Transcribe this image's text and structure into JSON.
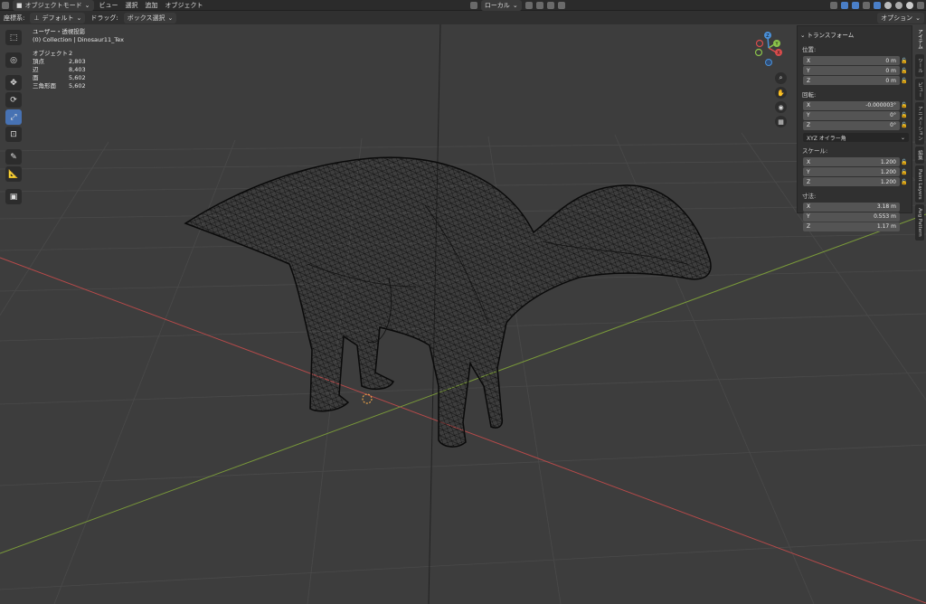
{
  "header": {
    "mode": "オブジェクトモード",
    "menus": [
      "ビュー",
      "選択",
      "追加",
      "オブジェクト"
    ],
    "transform_orientation": "ローカル"
  },
  "subheader": {
    "orientation_label": "座標系:",
    "orientation_value": "デフォルト",
    "drag_label": "ドラッグ:",
    "drag_value": "ボックス選択",
    "options": "オプション"
  },
  "overlay": {
    "view": "ユーザー・透視投影",
    "collection": "(0) Collection | Dinosaur11_Tex",
    "stats": [
      {
        "label": "オブジェクト",
        "value": "2"
      },
      {
        "label": "頂点",
        "value": "2,803"
      },
      {
        "label": "辺",
        "value": "8,403"
      },
      {
        "label": "面",
        "value": "5,602"
      },
      {
        "label": "三角形面",
        "value": "5,602"
      }
    ]
  },
  "npanel": {
    "title": "トランスフォーム",
    "location": {
      "label": "位置:",
      "x": "0 m",
      "y": "0 m",
      "z": "0 m"
    },
    "rotation": {
      "label": "回転:",
      "x": "-0.000003°",
      "y": "0°",
      "z": "0°"
    },
    "rotation_mode": "XYZ オイラー角",
    "scale": {
      "label": "スケール:",
      "x": "1.200",
      "y": "1.200",
      "z": "1.200"
    },
    "dimensions": {
      "label": "寸法:",
      "x": "3.18 m",
      "y": "0.553 m",
      "z": "1.17 m"
    },
    "axis_x": "X",
    "axis_y": "Y",
    "axis_z": "Z"
  },
  "side_tabs": [
    "アイテム",
    "ツール",
    "ビュー",
    "アニメーション",
    "編集",
    "Paint Layers",
    "Avg Pattern"
  ],
  "gizmo": {
    "x": "X",
    "y": "Y",
    "z": "Z"
  },
  "colors": {
    "x_axis": "#d94c4c",
    "y_axis": "#8bc34a",
    "z_axis": "#4a90d9",
    "active": "#4772b3"
  }
}
